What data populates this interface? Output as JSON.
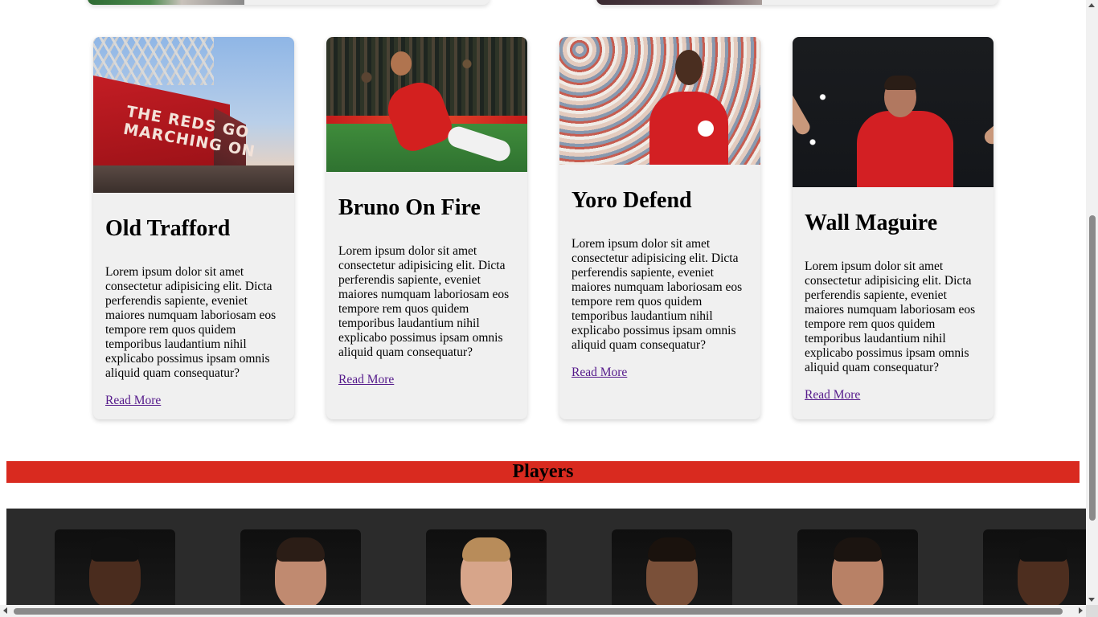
{
  "articles": [
    {
      "title": "Old Trafford",
      "image_text": "THE REDS GO MARCHING ON",
      "body": "Lorem ipsum dolor sit amet consectetur adipisicing elit. Dicta perferendis sapiente, eveniet maiores numquam laboriosam eos tempore rem quos quidem temporibus laudantium nihil explicabo possimus ipsam omnis aliquid quam consequatur?",
      "link": "Read More"
    },
    {
      "title": "Bruno On Fire",
      "body": "Lorem ipsum dolor sit amet consectetur adipisicing elit. Dicta perferendis sapiente, eveniet maiores numquam laboriosam eos tempore rem quos quidem temporibus laudantium nihil explicabo possimus ipsam omnis aliquid quam consequatur?",
      "link": "Read More"
    },
    {
      "title": "Yoro Defend",
      "body": "Lorem ipsum dolor sit amet consectetur adipisicing elit. Dicta perferendis sapiente, eveniet maiores numquam laboriosam eos tempore rem quos quidem temporibus laudantium nihil explicabo possimus ipsam omnis aliquid quam consequatur?",
      "link": "Read More"
    },
    {
      "title": "Wall Maguire",
      "body": "Lorem ipsum dolor sit amet consectetur adipisicing elit. Dicta perferendis sapiente, eveniet maiores numquam laboriosam eos tempore rem quos quidem temporibus laudantium nihil explicabo possimus ipsam omnis aliquid quam consequatur?",
      "link": "Read More"
    }
  ],
  "players_section": {
    "heading": "Players"
  },
  "colors": {
    "accent": "#d92a1f",
    "card_bg": "#f0f0f0",
    "players_bg": "#2b2b2b",
    "link": "#551a8b"
  }
}
